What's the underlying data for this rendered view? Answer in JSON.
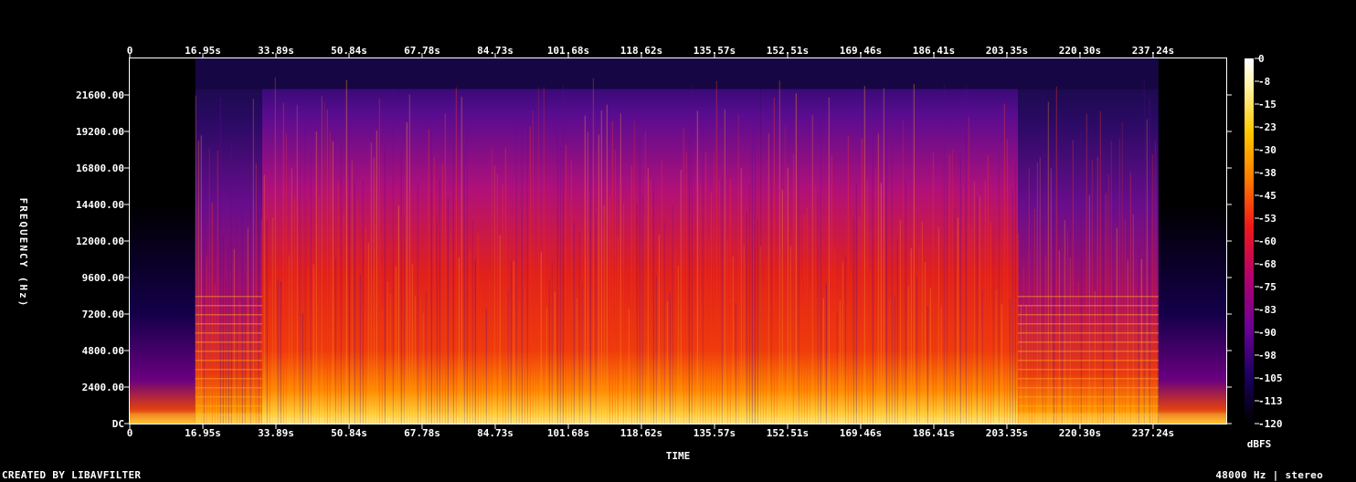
{
  "chart_data": {
    "type": "heatmap",
    "title": "",
    "xlabel": "TIME",
    "ylabel": "FREQUENCY (Hz)",
    "x_ticks": [
      "0",
      "16.95s",
      "33.89s",
      "50.84s",
      "67.78s",
      "84.73s",
      "101.68s",
      "118.62s",
      "135.57s",
      "152.51s",
      "169.46s",
      "186.41s",
      "203.35s",
      "220.30s",
      "237.24s"
    ],
    "x_tick_values": [
      0,
      16.95,
      33.89,
      50.84,
      67.78,
      84.73,
      101.68,
      118.62,
      135.57,
      152.51,
      169.46,
      186.41,
      203.35,
      220.3,
      237.24
    ],
    "xlim": [
      0,
      254.2
    ],
    "y_ticks": [
      "DC",
      "2400.00",
      "4800.00",
      "7200.00",
      "9600.00",
      "12000.00",
      "14400.00",
      "16800.00",
      "19200.00",
      "21600.00"
    ],
    "y_tick_values": [
      0,
      2400,
      4800,
      7200,
      9600,
      12000,
      14400,
      16800,
      19200,
      21600
    ],
    "ylim": [
      0,
      24000
    ],
    "colorbar": {
      "label": "dBFS",
      "ticks": [
        "0",
        "-8",
        "-15",
        "-23",
        "-30",
        "-38",
        "-45",
        "-53",
        "-60",
        "-68",
        "-75",
        "-83",
        "-90",
        "-98",
        "-105",
        "-113",
        "-120"
      ],
      "range": [
        -120,
        0
      ]
    },
    "segments": [
      {
        "t_start": 0,
        "t_end": 15.2,
        "level": "sparse low-frequency transients"
      },
      {
        "t_start": 15.2,
        "t_end": 30.7,
        "level": "periodic harmonic bands up to ~22000 Hz"
      },
      {
        "t_start": 30.7,
        "t_end": 146.2,
        "level": "dense broadband energy up to ~22000 Hz"
      },
      {
        "t_start": 146.2,
        "t_end": 205.9,
        "level": "dense broadband energy"
      },
      {
        "t_start": 205.9,
        "t_end": 238.5,
        "level": "broadband energy with harmonic bands"
      },
      {
        "t_start": 238.5,
        "t_end": 254.2,
        "level": "fade-out, sparse low-frequency transients"
      }
    ],
    "grid": false,
    "colormap": "intensity (black-purple-red-orange-yellow-white)"
  },
  "footer": {
    "left": "CREATED BY LIBAVFILTER",
    "right": "48000 Hz | stereo"
  },
  "colors": {
    "background": "#000000",
    "axis": "#ffffff",
    "text": "#ffffff"
  }
}
